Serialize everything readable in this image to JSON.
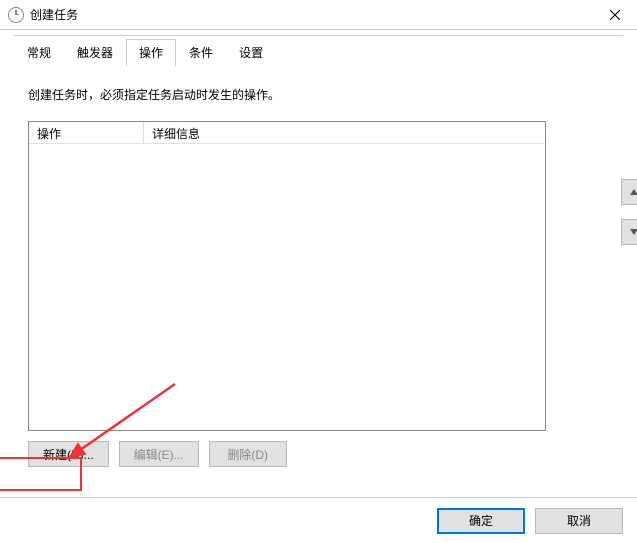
{
  "title": "创建任务",
  "tabs": [
    "常规",
    "触发器",
    "操作",
    "条件",
    "设置"
  ],
  "activeTab": 2,
  "description": "创建任务时，必须指定任务启动时发生的操作。",
  "table": {
    "columns": [
      "操作",
      "详细信息"
    ],
    "rows": []
  },
  "buttons": {
    "new": "新建(N)...",
    "edit": "编辑(E)...",
    "delete": "删除(D)"
  },
  "footer": {
    "ok": "确定",
    "cancel": "取消"
  }
}
